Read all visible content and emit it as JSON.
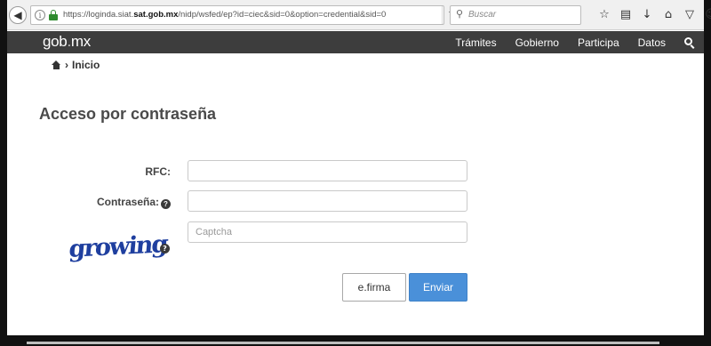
{
  "browser": {
    "url_prefix": "https://loginda.siat.",
    "url_domain": "sat.gob.mx",
    "url_path": "/nidp/wsfed/ep?id=ciec&sid=0&option=credential&sid=0",
    "search_placeholder": "Buscar",
    "icons": [
      "star-icon",
      "reading-list-icon",
      "download-icon",
      "home-icon",
      "pocket-icon",
      "smiley-icon"
    ]
  },
  "header": {
    "logo_part1": "gob",
    "logo_dot": ".",
    "logo_part2": "mx",
    "nav": [
      "Trámites",
      "Gobierno",
      "Participa",
      "Datos"
    ]
  },
  "breadcrumb": {
    "separator": "›",
    "current": "Inicio"
  },
  "page": {
    "title": "Acceso por contraseña"
  },
  "form": {
    "rfc_label": "RFC:",
    "rfc_value": "",
    "password_label": "Contraseña:",
    "password_value": "",
    "captcha_image_text": "growing",
    "captcha_placeholder": "Captcha",
    "efirma_label": "e.firma",
    "submit_label": "Enviar"
  },
  "colors": {
    "nav_bg": "#3d3d3d",
    "primary_button": "#4a90d9",
    "captcha_text": "#1f3f9f"
  }
}
